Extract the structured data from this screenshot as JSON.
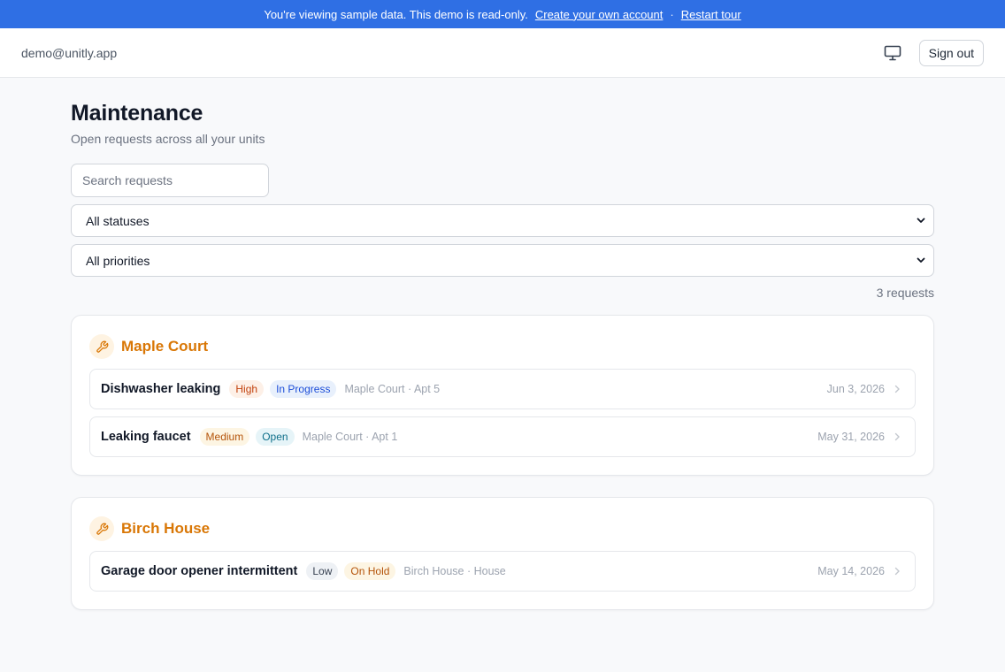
{
  "banner": {
    "message": "You're viewing sample data. This demo is read-only.",
    "create_link": "Create your own account",
    "separator": "·",
    "restart_link": "Restart tour",
    "bg_color": "#2f6fe4"
  },
  "topbar": {
    "email": "demo@unitly.app",
    "display_icon": "monitor-icon",
    "sign_out": "Sign out"
  },
  "page": {
    "title": "Maintenance",
    "subtitle": "Open requests across all your units"
  },
  "filters": {
    "search_placeholder": "Search requests",
    "status_selected": "All statuses",
    "priority_selected": "All priorities"
  },
  "count_text": "3 requests",
  "groups": [
    {
      "name": "Maple Court",
      "icon": "wrench-icon",
      "requests": [
        {
          "title": "Dishwasher leaking",
          "priority": "High",
          "status": "In Progress",
          "location": "Maple Court · Apt 5",
          "date": "Jun 3, 2026"
        },
        {
          "title": "Leaking faucet",
          "priority": "Medium",
          "status": "Open",
          "location": "Maple Court · Apt 1",
          "date": "May 31, 2026"
        }
      ]
    },
    {
      "name": "Birch House",
      "icon": "wrench-icon",
      "requests": [
        {
          "title": "Garage door opener intermittent",
          "priority": "Low",
          "status": "On Hold",
          "location": "Birch House · House",
          "date": "May 14, 2026"
        }
      ]
    }
  ],
  "colors": {
    "accent": "#d97706",
    "priority_high": {
      "bg": "#fdf0e7",
      "fg": "#c2410c"
    },
    "priority_medium": {
      "bg": "#fdf5e3",
      "fg": "#b45309"
    },
    "priority_low": {
      "bg": "#eef1f5",
      "fg": "#374151"
    },
    "status_in_progress": {
      "bg": "#e8f0fc",
      "fg": "#1d4ed8"
    },
    "status_open": {
      "bg": "#e6f4f8",
      "fg": "#0e6f8a"
    },
    "status_on_hold": {
      "bg": "#fdf5e3",
      "fg": "#b45309"
    }
  }
}
